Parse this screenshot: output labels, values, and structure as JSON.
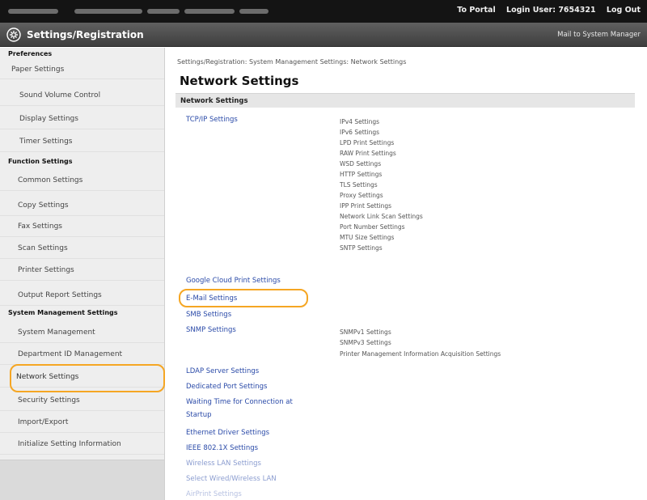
{
  "top_bar": {
    "to_portal": "To Portal",
    "login_user": "Login User: 7654321",
    "log_out": "Log Out"
  },
  "title_bar": {
    "title": "Settings/Registration",
    "mail_link": "Mail to System Manager"
  },
  "sidebar": {
    "preferences_head": "Preferences",
    "preferences": [
      "Paper Settings",
      "Sound Volume Control",
      "Display Settings",
      "Timer Settings"
    ],
    "function_head": "Function Settings",
    "function": [
      "Common Settings",
      "Copy Settings",
      "Fax Settings",
      "Scan Settings",
      "Printer Settings",
      "Output Report Settings"
    ],
    "system_head": "System Management Settings",
    "system": [
      "System Management",
      "Department ID Management",
      "Network Settings",
      "Security Settings",
      "Import/Export",
      "Initialize Setting Information"
    ],
    "selected": "Network Settings"
  },
  "main": {
    "breadcrumb": "Settings/Registration: System Management Settings: Network Settings",
    "title": "Network Settings",
    "section": "Network Settings",
    "links": [
      "TCP/IP Settings",
      "Google Cloud Print Settings",
      "E-Mail Settings",
      "SMB Settings",
      "SNMP Settings",
      "LDAP Server Settings",
      "Dedicated Port Settings",
      "Waiting Time for Connection at",
      "Startup",
      "Ethernet Driver Settings",
      "IEEE 802.1X Settings",
      "Wireless LAN Settings",
      "Select Wired/Wireless LAN",
      "AirPrint Settings"
    ],
    "tcpip_sub": [
      "IPv4 Settings",
      "IPv6 Settings",
      "LPD Print Settings",
      "RAW Print Settings",
      "WSD Settings",
      "HTTP Settings",
      "TLS Settings",
      "Proxy Settings",
      "IPP Print Settings",
      "Network Link Scan Settings",
      "Port Number Settings",
      "MTU Size Settings",
      "SNTP Settings"
    ],
    "snmp_sub": [
      "SNMPv1 Settings",
      "SNMPv3 Settings",
      "Printer Management Information Acquisition Settings"
    ]
  },
  "colors": {
    "highlight": "#f5a623",
    "link": "#2a4aa8"
  }
}
